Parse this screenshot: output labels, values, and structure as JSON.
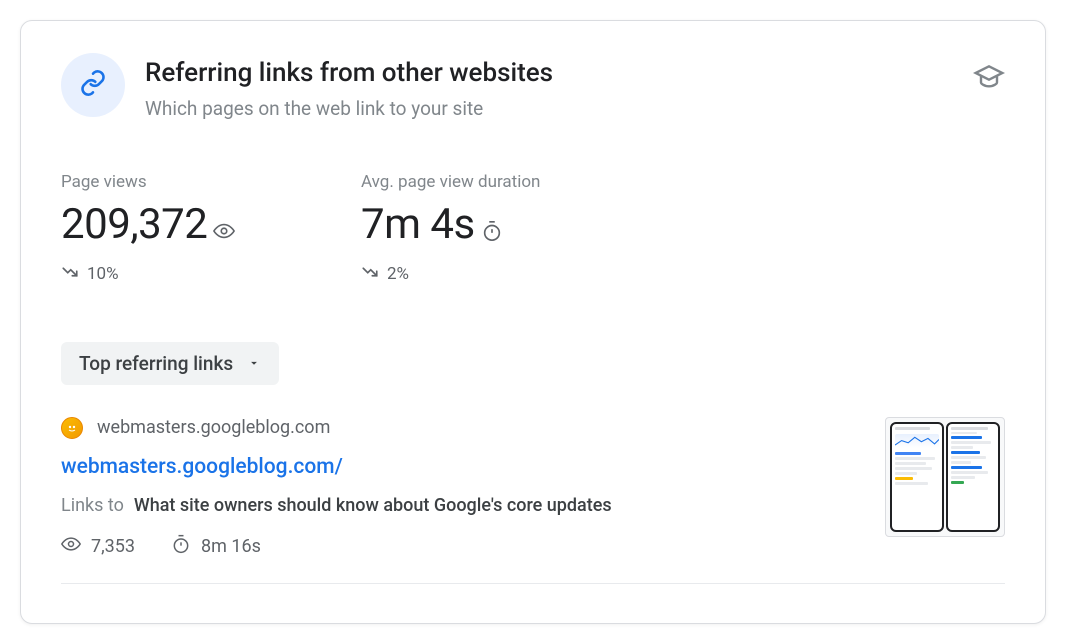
{
  "header": {
    "title": "Referring links from other websites",
    "subtitle": "Which pages on the web link to your site"
  },
  "metrics": {
    "page_views": {
      "label": "Page views",
      "value": "209,372",
      "change": "10%"
    },
    "avg_duration": {
      "label": "Avg. page view duration",
      "value": "7m 4s",
      "change": "2%"
    }
  },
  "dropdown": {
    "label": "Top referring links"
  },
  "item": {
    "domain": "webmasters.googleblog.com",
    "url": "webmasters.googleblog.com/",
    "links_to_label": "Links to",
    "links_to_title": "What site owners should know about Google's core updates",
    "views": "7,353",
    "duration": "8m 16s"
  }
}
